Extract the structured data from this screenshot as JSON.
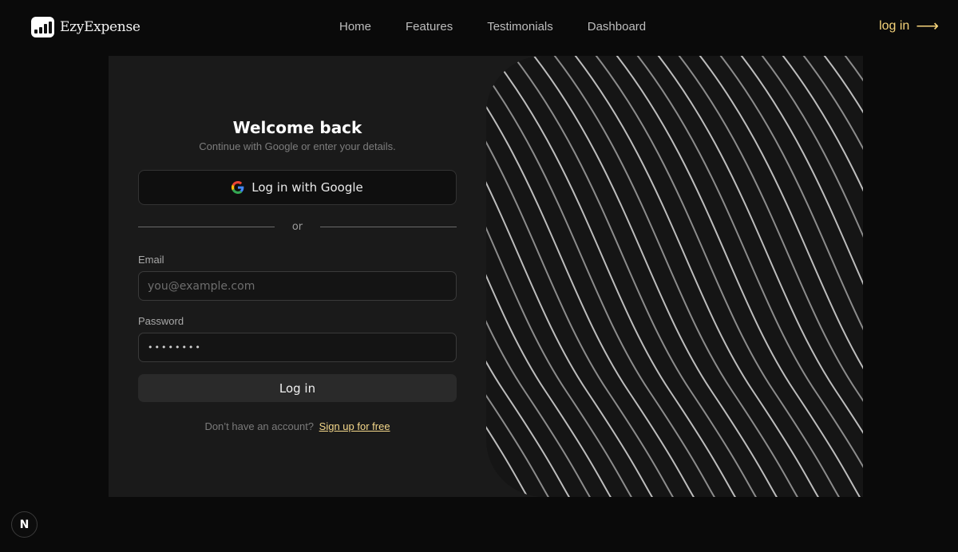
{
  "brand": {
    "name": "EzyExpense",
    "logo_icon": "bar-chart-icon"
  },
  "nav": {
    "items": [
      "Home",
      "Features",
      "Testimonials",
      "Dashboard"
    ]
  },
  "header": {
    "login_label": "log in",
    "login_arrow": "⟶"
  },
  "login_form": {
    "title": "Welcome back",
    "subtitle": "Continue with Google or enter your details.",
    "google_button_label": "Log in with Google",
    "divider_text": "or",
    "email_label": "Email",
    "email_placeholder": "you@example.com",
    "password_label": "Password",
    "password_value": "••••••••",
    "submit_label": "Log in",
    "signup_prompt": "Don’t have an account?",
    "signup_link": "Sign up for free"
  },
  "dev_badge": {
    "label": "N"
  },
  "colors": {
    "background": "#0a0a0a",
    "card": "#1a1a1a",
    "accent": "#f5d37a"
  }
}
